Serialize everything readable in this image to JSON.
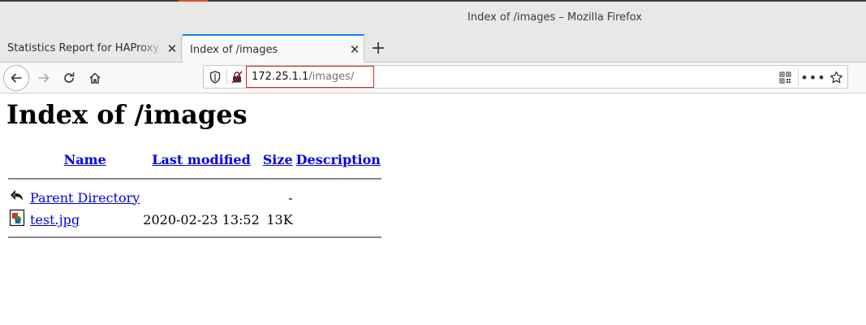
{
  "window": {
    "title": "Index of /images – Mozilla Firefox"
  },
  "tabs": [
    {
      "label": "Statistics Report for HAProxy",
      "active": false
    },
    {
      "label": "Index of /images",
      "active": true
    }
  ],
  "toolbar": {
    "url_host": "172.25.1.1",
    "url_path": "/images/",
    "more_label": "•••"
  },
  "page": {
    "heading": "Index of /images",
    "columns": {
      "name": "Name",
      "last_modified": "Last modified",
      "size": "Size",
      "description": "Description"
    },
    "rows": [
      {
        "icon": "back-arrow-icon",
        "name": "Parent Directory",
        "last_modified": "",
        "size": "-",
        "description": ""
      },
      {
        "icon": "image-file-icon",
        "name": "test.jpg",
        "last_modified": "2020-02-23 13:52",
        "size": "13K",
        "description": ""
      }
    ]
  },
  "colors": {
    "link": "#0000ee",
    "active_tab_accent": "#0a84ff",
    "url_highlight_border": "#cc2b2b"
  }
}
